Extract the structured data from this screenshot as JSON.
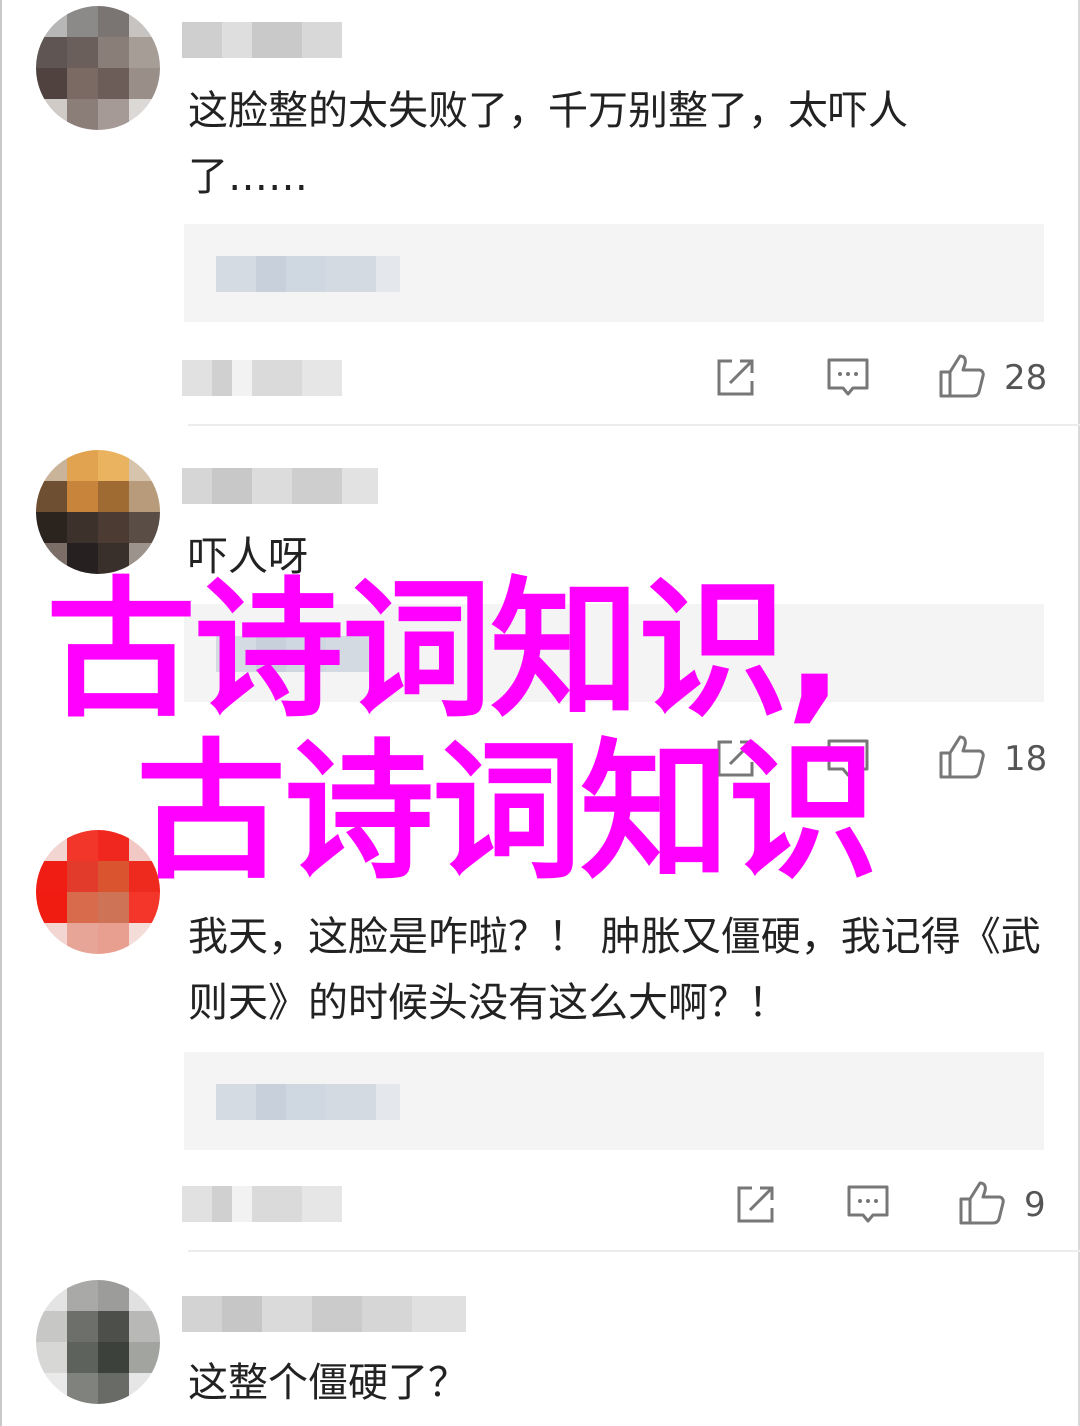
{
  "comments": [
    {
      "text": "这脸整的太失败了，千万别整了，太吓人了……",
      "like_count": "28"
    },
    {
      "text": "吓人呀",
      "like_count": "18"
    },
    {
      "text": "我天，这脸是咋啦？！ 肿胀又僵硬，我记得《武则天》的时候头没有这么大啊？！",
      "like_count": "9"
    },
    {
      "text": "这整个僵硬了？",
      "like_count": ""
    }
  ],
  "watermark": {
    "line1": "古诗词知识,",
    "line2": "古诗词知识",
    "color": "#ff00ff"
  },
  "icons": {
    "share": "share-icon",
    "reply": "comment-icon",
    "like": "thumbs-up-icon"
  }
}
